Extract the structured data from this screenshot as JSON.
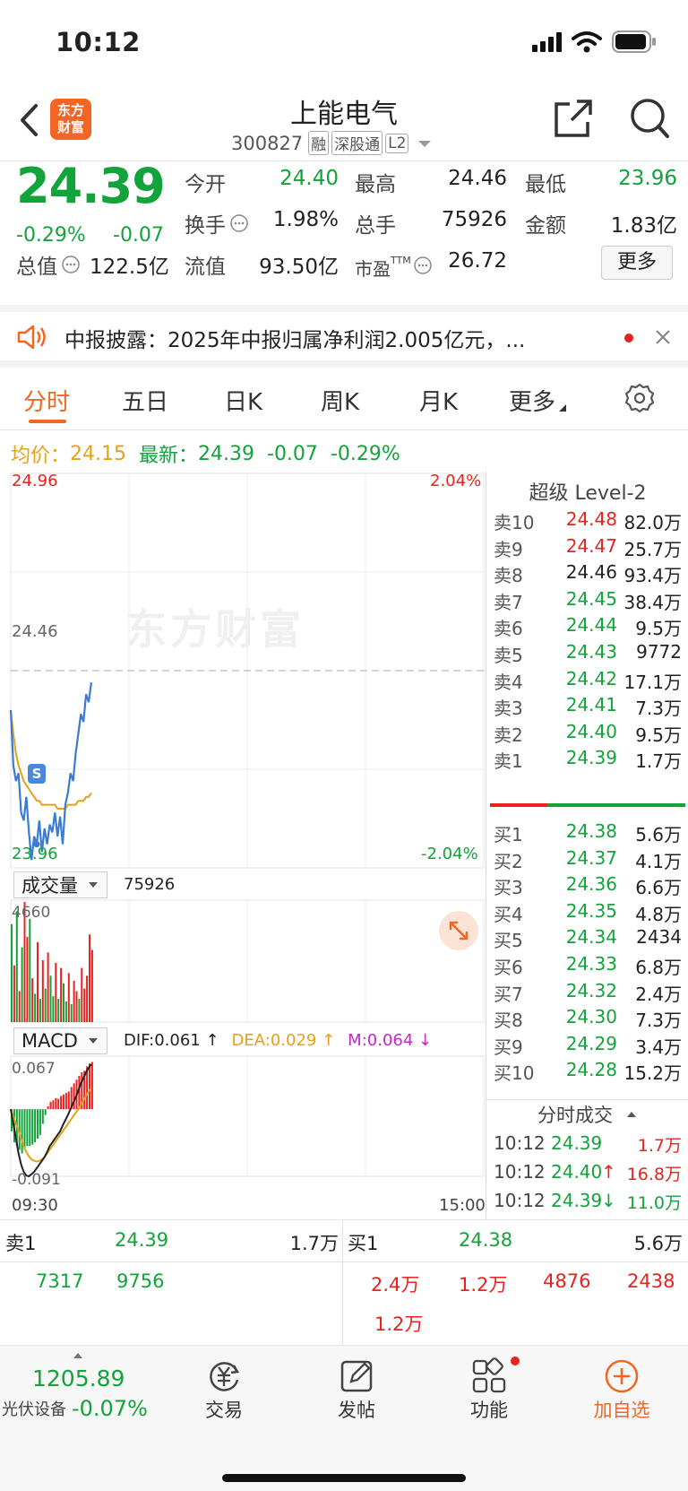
{
  "status_bar": {
    "time": "10:12"
  },
  "header": {
    "logo_text_line1": "东方",
    "logo_text_line2": "财富",
    "stock_name": "上能电气",
    "stock_code": "300827",
    "tags": [
      "融",
      "深股通",
      "L2"
    ]
  },
  "quote": {
    "price": "24.39",
    "change_pct": "-0.29%",
    "change_amt": "-0.07",
    "fields": {
      "open_label": "今开",
      "open": "24.40",
      "high_label": "最高",
      "high": "24.46",
      "low_label": "最低",
      "low": "23.96",
      "turnover_label": "换手",
      "turnover": "1.98%",
      "volume_label": "总手",
      "volume": "75926",
      "amount_label": "金额",
      "amount": "1.83亿",
      "mktcap_label": "总值",
      "mktcap": "122.5亿",
      "float_label": "流值",
      "float": "93.50亿",
      "pe_label": "市盈",
      "pe_sup": "TTM",
      "pe": "26.72"
    },
    "more_button": "更多"
  },
  "news": {
    "text": "中报披露：2025年中报归属净利润2.005亿元，..."
  },
  "tabs": [
    "分时",
    "五日",
    "日K",
    "周K",
    "月K",
    "更多"
  ],
  "active_tab": 0,
  "avg_line": {
    "avg_label": "均价：",
    "avg_value": "24.15",
    "latest_label": "最新：",
    "latest_value": "24.39",
    "latest_change": "-0.07",
    "latest_pct": "-0.29%"
  },
  "chart": {
    "price_top": "24.96",
    "price_mid": "24.46",
    "price_bottom": "23.96",
    "pct_top": "2.04%",
    "pct_bottom": "-2.04%",
    "watermark": "东方财富",
    "volume_selector": "成交量",
    "volume_total": "75926",
    "volume_max": "4660",
    "macd_selector": "MACD",
    "macd_dif": "DIF:0.061 ↑",
    "macd_dea": "DEA:0.029 ↑",
    "macd_m": "M:0.064 ↓",
    "macd_top": "0.067",
    "macd_bottom": "-0.091",
    "time_start": "09:30",
    "time_end": "15:00",
    "trade_marker": "S",
    "price_range": [
      23.96,
      24.96
    ],
    "price_series": [
      24.36,
      24.22,
      24.18,
      24.2,
      24.1,
      24.08,
      24.14,
      24.05,
      23.98,
      24.04,
      24.02,
      24.08,
      24.0,
      24.06,
      24.02,
      24.07,
      24.05,
      24.1,
      24.04,
      24.09,
      24.02,
      24.12,
      24.15,
      24.2,
      24.18,
      24.25,
      24.3,
      24.35,
      24.33,
      24.4,
      24.38,
      24.43
    ],
    "avg_series": [
      24.36,
      24.3,
      24.25,
      24.22,
      24.2,
      24.18,
      24.17,
      24.16,
      24.15,
      24.14,
      24.13,
      24.13,
      24.12,
      24.12,
      24.12,
      24.12,
      24.12,
      24.12,
      24.11,
      24.11,
      24.11,
      24.11,
      24.12,
      24.12,
      24.12,
      24.12,
      24.13,
      24.13,
      24.13,
      24.14,
      24.14,
      24.15
    ],
    "volume_series": [
      3800,
      2200,
      4300,
      1200,
      2900,
      4660,
      3300,
      4000,
      1700,
      1100,
      3100,
      900,
      2400,
      1300,
      2700,
      1800,
      1000,
      2300,
      900,
      2100,
      1500,
      800,
      1900,
      700,
      1600,
      1200,
      900,
      2100,
      1300,
      1800,
      3400,
      2800
    ],
    "volume_up": [
      false,
      true,
      false,
      true,
      false,
      true,
      true,
      false,
      true,
      false,
      true,
      false,
      true,
      false,
      true,
      false,
      false,
      true,
      false,
      true,
      false,
      false,
      true,
      false,
      true,
      true,
      false,
      true,
      true,
      true,
      true,
      true
    ],
    "macd_hist": [
      -0.03,
      -0.045,
      -0.05,
      -0.055,
      -0.06,
      -0.055,
      -0.05,
      -0.05,
      -0.048,
      -0.045,
      -0.04,
      -0.035,
      -0.02,
      -0.008,
      0.004,
      0.01,
      0.012,
      0.015,
      0.014,
      0.018,
      0.02,
      0.022,
      0.024,
      0.03,
      0.035,
      0.04,
      0.045,
      0.05,
      0.052,
      0.058,
      0.062,
      0.064
    ],
    "macd_dif_series": [
      -0.0,
      -0.02,
      -0.04,
      -0.06,
      -0.075,
      -0.085,
      -0.09,
      -0.091,
      -0.088,
      -0.085,
      -0.08,
      -0.075,
      -0.07,
      -0.065,
      -0.058,
      -0.05,
      -0.045,
      -0.04,
      -0.035,
      -0.03,
      -0.022,
      -0.015,
      -0.008,
      0.0,
      0.008,
      0.016,
      0.025,
      0.035,
      0.042,
      0.05,
      0.056,
      0.061
    ],
    "macd_dea_series": [
      -0.0,
      -0.01,
      -0.02,
      -0.03,
      -0.04,
      -0.05,
      -0.058,
      -0.064,
      -0.068,
      -0.07,
      -0.071,
      -0.07,
      -0.068,
      -0.065,
      -0.06,
      -0.055,
      -0.05,
      -0.045,
      -0.04,
      -0.035,
      -0.03,
      -0.025,
      -0.02,
      -0.015,
      -0.01,
      -0.005,
      0.0,
      0.006,
      0.012,
      0.018,
      0.024,
      0.029
    ]
  },
  "level2": {
    "title": "超级 Level-2",
    "sells": [
      {
        "label": "卖10",
        "price": "24.48",
        "vol": "82.0万",
        "color": "red"
      },
      {
        "label": "卖9",
        "price": "24.47",
        "vol": "25.7万",
        "color": "red"
      },
      {
        "label": "卖8",
        "price": "24.46",
        "vol": "93.4万",
        "color": "dark"
      },
      {
        "label": "卖7",
        "price": "24.45",
        "vol": "38.4万",
        "color": "green"
      },
      {
        "label": "卖6",
        "price": "24.44",
        "vol": "9.5万",
        "color": "green"
      },
      {
        "label": "卖5",
        "price": "24.43",
        "vol": "9772",
        "color": "green"
      },
      {
        "label": "卖4",
        "price": "24.42",
        "vol": "17.1万",
        "color": "green"
      },
      {
        "label": "卖3",
        "price": "24.41",
        "vol": "7.3万",
        "color": "green"
      },
      {
        "label": "卖2",
        "price": "24.40",
        "vol": "9.5万",
        "color": "green"
      },
      {
        "label": "卖1",
        "price": "24.39",
        "vol": "1.7万",
        "color": "green"
      }
    ],
    "buys": [
      {
        "label": "买1",
        "price": "24.38",
        "vol": "5.6万",
        "color": "green"
      },
      {
        "label": "买2",
        "price": "24.37",
        "vol": "4.1万",
        "color": "green"
      },
      {
        "label": "买3",
        "price": "24.36",
        "vol": "6.6万",
        "color": "green"
      },
      {
        "label": "买4",
        "price": "24.35",
        "vol": "4.8万",
        "color": "green"
      },
      {
        "label": "买5",
        "price": "24.34",
        "vol": "2434",
        "color": "green"
      },
      {
        "label": "买6",
        "price": "24.33",
        "vol": "6.8万",
        "color": "green"
      },
      {
        "label": "买7",
        "price": "24.32",
        "vol": "2.4万",
        "color": "green"
      },
      {
        "label": "买8",
        "price": "24.30",
        "vol": "7.3万",
        "color": "green"
      },
      {
        "label": "买9",
        "price": "24.29",
        "vol": "3.4万",
        "color": "green"
      },
      {
        "label": "买10",
        "price": "24.28",
        "vol": "15.2万",
        "color": "green"
      }
    ],
    "ticks_title": "分时成交",
    "ticks": [
      {
        "time": "10:12",
        "price": "24.39",
        "arrow": "",
        "vol": "1.7万",
        "vol_color": "red"
      },
      {
        "time": "10:12",
        "price": "24.40",
        "arrow": "↑",
        "vol": "16.8万",
        "vol_color": "red"
      },
      {
        "time": "10:12",
        "price": "24.39",
        "arrow": "↓",
        "vol": "11.0万",
        "vol_color": "green"
      }
    ]
  },
  "bottom_quote": {
    "sell1_label": "卖1",
    "sell1_price": "24.39",
    "sell1_vol": "1.7万",
    "buy1_label": "买1",
    "buy1_price": "24.38",
    "buy1_vol": "5.6万",
    "sell_queue": [
      "7317",
      "9756"
    ],
    "buy_queue": [
      "2.4万",
      "1.2万",
      "4876",
      "2438",
      "1.2万"
    ]
  },
  "bottom_nav": {
    "index_value": "1205.89",
    "index_name": "光伏设备",
    "index_pct": "-0.07%",
    "items": [
      "交易",
      "发帖",
      "功能",
      "加自选"
    ]
  }
}
